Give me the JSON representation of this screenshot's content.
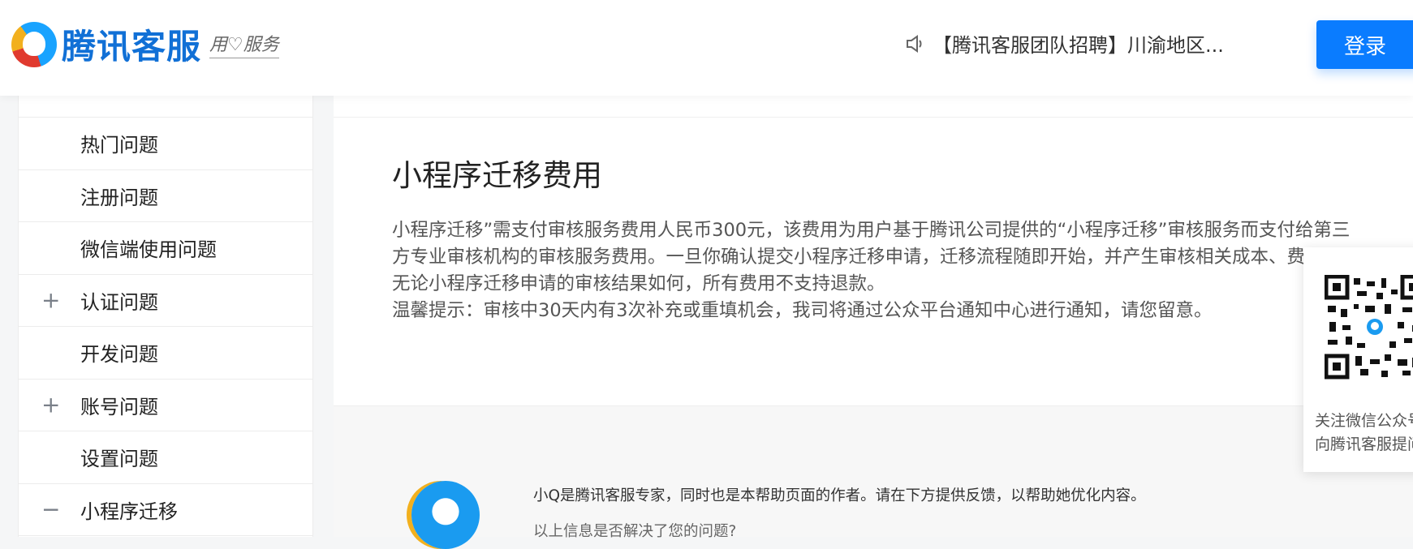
{
  "header": {
    "logo_text": "腾讯客服",
    "logo_slogan": "用♡服务",
    "notice_icon": "speaker-icon",
    "notice_text": "【腾讯客服团队招聘】川渝地区...",
    "login_label": "登录"
  },
  "sidebar": {
    "items": [
      {
        "label": "热门问题",
        "sign": ""
      },
      {
        "label": "注册问题",
        "sign": ""
      },
      {
        "label": "微信端使用问题",
        "sign": ""
      },
      {
        "label": "认证问题",
        "sign": "+"
      },
      {
        "label": "开发问题",
        "sign": ""
      },
      {
        "label": "账号问题",
        "sign": "+"
      },
      {
        "label": "设置问题",
        "sign": ""
      },
      {
        "label": "小程序迁移",
        "sign": "−"
      }
    ]
  },
  "article": {
    "title": "小程序迁移费用",
    "paragraph1": "小程序迁移”需支付审核服务费用人民币300元，该费用为用户基于腾讯公司提供的“小程序迁移”审核服务而支付给第三方专业审核机构的审核服务费用。一旦你确认提交小程序迁移申请，迁移流程随即开始，并产生审核相关成本、费用。无论小程序迁移申请的审核结果如何，所有费用不支持退款。",
    "paragraph2": "温馨提示：审核中30天内有3次补充或重填机会，我司将通过公众平台通知中心进行通知，请您留意。"
  },
  "feedback": {
    "intro": "小Q是腾讯客服专家，同时也是本帮助页面的作者。请在下方提供反馈，以帮助她优化内容。",
    "question": "以上信息是否解决了您的问题?"
  },
  "qr_card": {
    "line1": "关注微信公众号",
    "line2": "向腾讯客服提问"
  }
}
